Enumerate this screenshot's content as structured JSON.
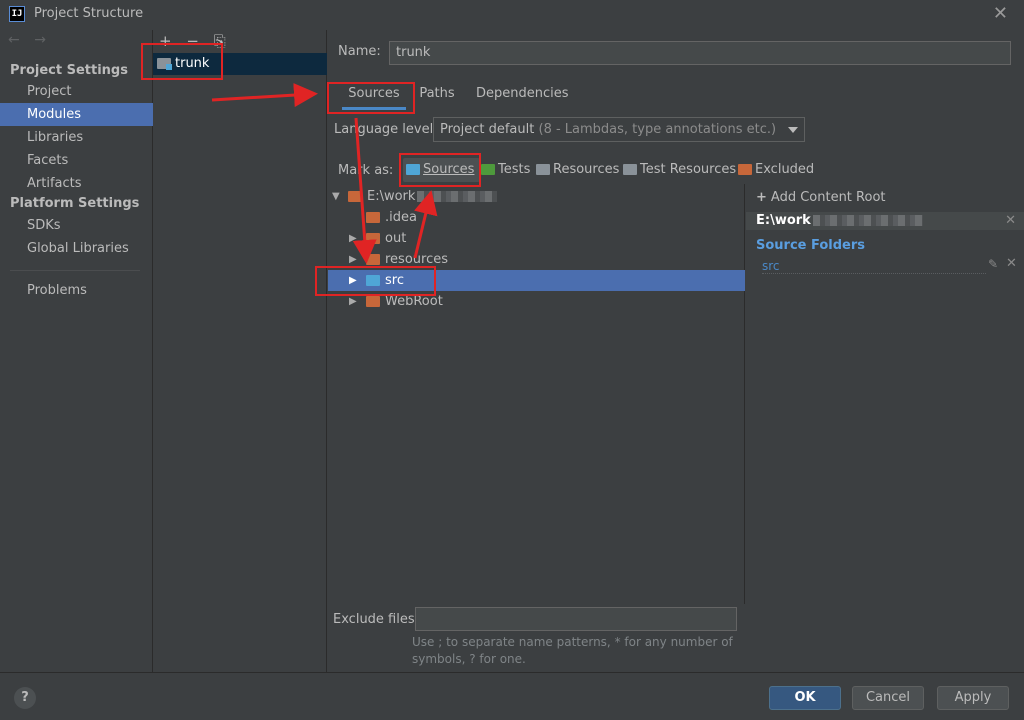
{
  "window": {
    "title": "Project Structure",
    "app_icon": "IJ"
  },
  "sidebar": {
    "nav_back": "←",
    "nav_forward": "→",
    "section_project": "Project Settings",
    "section_platform": "Platform Settings",
    "items": [
      {
        "label": "Project"
      },
      {
        "label": "Modules"
      },
      {
        "label": "Libraries"
      },
      {
        "label": "Facets"
      },
      {
        "label": "Artifacts"
      },
      {
        "label": "SDKs"
      },
      {
        "label": "Global Libraries"
      },
      {
        "label": "Problems"
      }
    ]
  },
  "modules": {
    "toolbar": {
      "add": "+",
      "remove": "−",
      "copy": "⎘"
    },
    "selected_module": "trunk"
  },
  "main": {
    "name_label": "Name:",
    "name_value": "trunk",
    "tabs": [
      {
        "label": "Sources"
      },
      {
        "label": "Paths"
      },
      {
        "label": "Dependencies"
      }
    ],
    "language_level_label": "Language level:",
    "language_level_value": "Project default",
    "language_level_detail": "(8 - Lambdas, type annotations etc.)",
    "mark_as_label": "Mark as:",
    "mark_as": [
      {
        "label": "Sources",
        "color": "#4fa6d6"
      },
      {
        "label": "Tests",
        "color": "#4e9a3c"
      },
      {
        "label": "Resources",
        "color": "#8a9299"
      },
      {
        "label": "Test Resources",
        "color": "#8a9299"
      },
      {
        "label": "Excluded",
        "color": "#c7673a"
      }
    ],
    "tree": {
      "root": "E:\\work",
      "children": [
        {
          "label": ".idea"
        },
        {
          "label": "out"
        },
        {
          "label": "resources"
        },
        {
          "label": "src"
        },
        {
          "label": "WebRoot"
        }
      ]
    },
    "exclude_label": "Exclude files:",
    "exclude_hint_1": "Use ; to separate name patterns, * for any number of",
    "exclude_hint_2": "symbols, ? for one."
  },
  "right_panel": {
    "add_content_root": "Add Content Root",
    "content_root": "E:\\work",
    "source_folders_heading": "Source Folders",
    "source_folder": "src"
  },
  "footer": {
    "help": "?",
    "ok": "OK",
    "cancel": "Cancel",
    "apply": "Apply"
  },
  "colors": {
    "background": "#3c3f41",
    "selection": "#4b6eaf",
    "accent": "#4a88c7",
    "annotation": "#e02424"
  }
}
